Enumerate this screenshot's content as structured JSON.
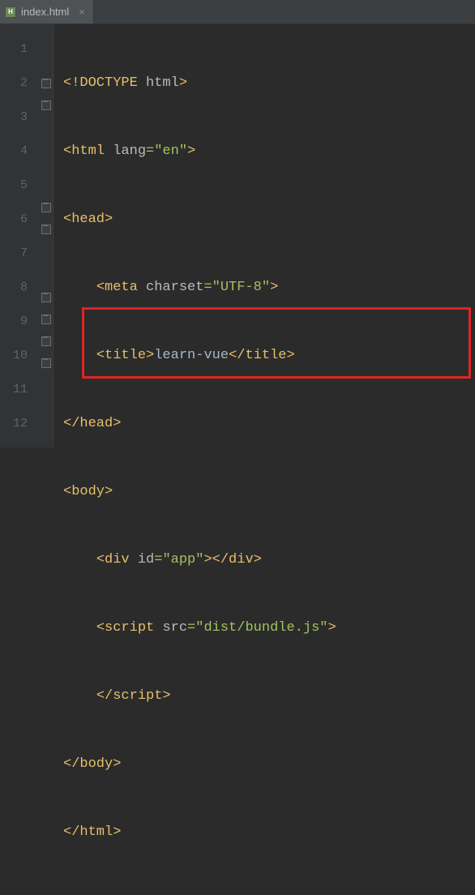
{
  "tab": {
    "filename": "index.html",
    "close_glyph": "×",
    "icon_letter": "H"
  },
  "gutter": {
    "lines": [
      "1",
      "2",
      "3",
      "4",
      "5",
      "6",
      "7",
      "8",
      "9",
      "10",
      "11",
      "12"
    ]
  },
  "code": {
    "l1": {
      "doctype_open": "<!DOCTYPE ",
      "doctype_name": "html",
      "gt": ">"
    },
    "l2": {
      "open": "<html ",
      "attr": "lang",
      "eq": "=",
      "val": "\"en\"",
      "gt": ">"
    },
    "l3": {
      "open": "<head",
      "gt": ">"
    },
    "l4": {
      "open": "<meta ",
      "attr": "charset",
      "eq": "=",
      "val": "\"UTF-8\"",
      "gt": ">"
    },
    "l5": {
      "open": "<title>",
      "text": "learn-vue",
      "close": "</title>"
    },
    "l6": {
      "close": "</head>"
    },
    "l7": {
      "open": "<body",
      "gt": ">"
    },
    "l8": {
      "open": "<div ",
      "attr": "id",
      "eq": "=",
      "val": "\"app\"",
      "gt": ">",
      "close": "</div>"
    },
    "l9": {
      "open": "<script ",
      "attr": "src",
      "eq": "=",
      "val": "\"dist/bundle.js\"",
      "gt": ">"
    },
    "l10": {
      "close_script": "</script>"
    },
    "l11": {
      "close": "</body>"
    },
    "l12": {
      "close": "</html>"
    }
  }
}
